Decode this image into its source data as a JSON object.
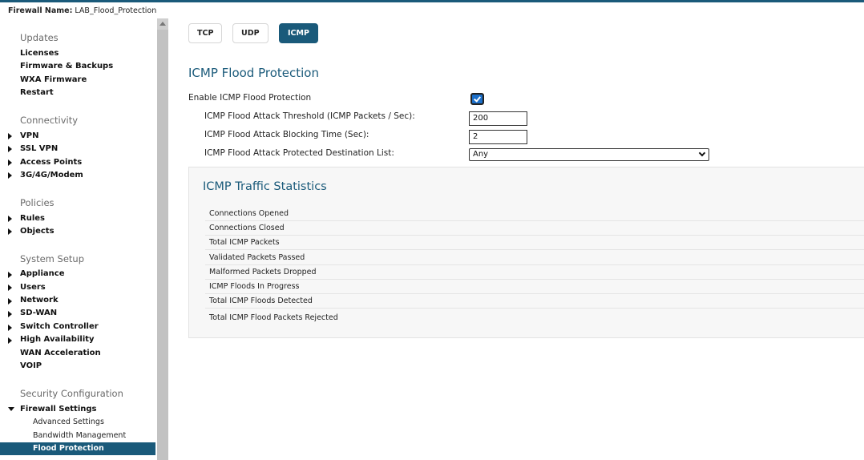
{
  "header": {
    "firewall_label": "Firewall Name:",
    "firewall_name": "LAB_Flood_Protection"
  },
  "sidebar": {
    "sections": [
      {
        "title": "Updates",
        "items": [
          {
            "label": "Licenses",
            "expandable": false
          },
          {
            "label": "Firmware & Backups",
            "expandable": false
          },
          {
            "label": "WXA Firmware",
            "expandable": false
          },
          {
            "label": "Restart",
            "expandable": false
          }
        ]
      },
      {
        "title": "Connectivity",
        "items": [
          {
            "label": "VPN",
            "expandable": true
          },
          {
            "label": "SSL VPN",
            "expandable": true
          },
          {
            "label": "Access Points",
            "expandable": true
          },
          {
            "label": "3G/4G/Modem",
            "expandable": true
          }
        ]
      },
      {
        "title": "Policies",
        "items": [
          {
            "label": "Rules",
            "expandable": true
          },
          {
            "label": "Objects",
            "expandable": true
          }
        ]
      },
      {
        "title": "System Setup",
        "items": [
          {
            "label": "Appliance",
            "expandable": true
          },
          {
            "label": "Users",
            "expandable": true
          },
          {
            "label": "Network",
            "expandable": true
          },
          {
            "label": "SD-WAN",
            "expandable": true
          },
          {
            "label": "Switch Controller",
            "expandable": true
          },
          {
            "label": "High Availability",
            "expandable": true
          },
          {
            "label": "WAN Acceleration",
            "expandable": false
          },
          {
            "label": "VOIP",
            "expandable": false
          }
        ]
      },
      {
        "title": "Security Configuration",
        "items": [
          {
            "label": "Firewall Settings",
            "expandable": true,
            "expanded": true
          }
        ]
      }
    ],
    "firewall_sub": [
      {
        "label": "Advanced Settings",
        "active": false
      },
      {
        "label": "Bandwidth Management",
        "active": false
      },
      {
        "label": "Flood Protection",
        "active": true
      }
    ]
  },
  "tabs": [
    {
      "label": "TCP",
      "active": false
    },
    {
      "label": "UDP",
      "active": false
    },
    {
      "label": "ICMP",
      "active": true
    }
  ],
  "form": {
    "title": "ICMP Flood Protection",
    "enable_label": "Enable ICMP Flood Protection",
    "enable_checked": true,
    "threshold_label": "ICMP Flood Attack Threshold (ICMP Packets / Sec):",
    "threshold_value": "200",
    "blocking_label": "ICMP Flood Attack Blocking Time (Sec):",
    "blocking_value": "2",
    "destination_label": "ICMP Flood Attack Protected Destination List:",
    "destination_value": "Any"
  },
  "stats": {
    "title": "ICMP Traffic Statistics",
    "rows": [
      "Connections Opened",
      "Connections Closed",
      "Total ICMP Packets",
      "Validated Packets Passed",
      "Malformed Packets Dropped",
      "ICMP Floods In Progress",
      "Total ICMP Floods Detected",
      "Total ICMP Flood Packets Rejected"
    ]
  },
  "colors": {
    "accent": "#1a5a7a",
    "checkbox": "#1c6fc9"
  }
}
